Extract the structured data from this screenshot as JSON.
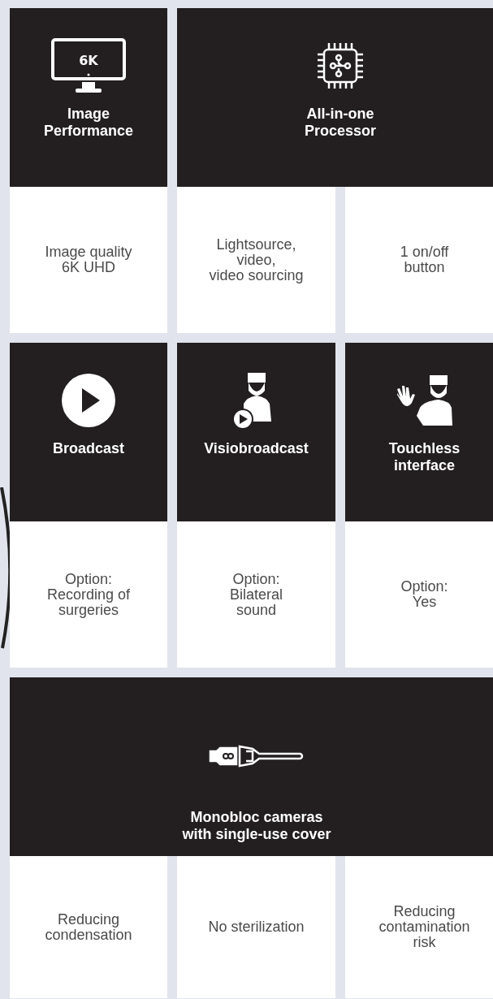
{
  "sections": [
    {
      "features": [
        {
          "kind": "monitor",
          "badge": "6K",
          "title": "Image\nPerformance"
        },
        {
          "kind": "chip",
          "title": "All-in-one\nProcessor"
        }
      ],
      "specs": [
        "Image quality\n6K UHD",
        "Lightsource,\nvideo,\nvideo sourcing",
        "1 on/off\nbutton"
      ]
    },
    {
      "features": [
        {
          "kind": "play",
          "title": "Broadcast"
        },
        {
          "kind": "doctor-play",
          "title": "Visiobroadcast"
        },
        {
          "kind": "doctor-wave",
          "title": "Touchless\ninterface"
        }
      ],
      "specs": [
        "Option:\nRecording of\nsurgeries",
        "Option:\nBilateral\nsound",
        "Option:\nYes"
      ]
    },
    {
      "features": [
        {
          "kind": "camera",
          "title": "Monobloc cameras\nwith single-use cover"
        }
      ],
      "specs": [
        "Reducing\ncondensation",
        "No sterilization",
        "Reducing\ncontamination\nrisk"
      ]
    }
  ]
}
